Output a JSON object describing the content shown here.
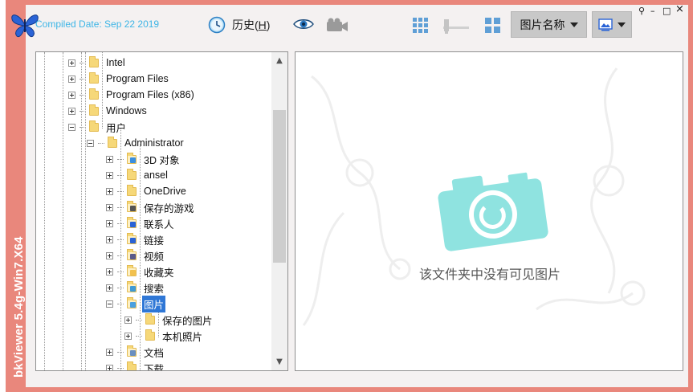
{
  "app": {
    "vertical_title": "bkViewer 5.4g-Win7.X64",
    "compiled_date": "Compiled Date: Sep 22 2019"
  },
  "toolbar": {
    "history_label": "历史",
    "history_hotkey": "H",
    "sort_label": "图片名称",
    "icons": [
      "history-clock-icon",
      "eye-icon",
      "camera-icon",
      "grid-large-icon",
      "slider-icon",
      "grid-small-icon",
      "image-view-icon"
    ]
  },
  "window_controls": {
    "pin": "⚲",
    "minimize": "–",
    "maximize": "□",
    "close": "×"
  },
  "tree": {
    "nodes": [
      {
        "label": "Intel",
        "level": 2,
        "expander": "plus",
        "icon": "folder-icon"
      },
      {
        "label": "Program Files",
        "level": 2,
        "expander": "plus",
        "icon": "folder-icon"
      },
      {
        "label": "Program Files (x86)",
        "level": 2,
        "expander": "plus",
        "icon": "folder-icon"
      },
      {
        "label": "Windows",
        "level": 2,
        "expander": "plus",
        "icon": "folder-icon"
      },
      {
        "label": "用户",
        "level": 2,
        "expander": "minus",
        "icon": "folder-icon"
      },
      {
        "label": "Administrator",
        "level": 3,
        "expander": "minus",
        "icon": "folder-icon"
      },
      {
        "label": "3D 对象",
        "level": 4,
        "expander": "plus",
        "icon": "3d-objects-icon"
      },
      {
        "label": "ansel",
        "level": 4,
        "expander": "plus",
        "icon": "folder-icon"
      },
      {
        "label": "OneDrive",
        "level": 4,
        "expander": "plus",
        "icon": "folder-icon"
      },
      {
        "label": "保存的游戏",
        "level": 4,
        "expander": "plus",
        "icon": "saved-games-icon"
      },
      {
        "label": "联系人",
        "level": 4,
        "expander": "plus",
        "icon": "contacts-icon"
      },
      {
        "label": "链接",
        "level": 4,
        "expander": "plus",
        "icon": "links-icon"
      },
      {
        "label": "视频",
        "level": 4,
        "expander": "plus",
        "icon": "videos-icon"
      },
      {
        "label": "收藏夹",
        "level": 4,
        "expander": "plus",
        "icon": "favorites-icon"
      },
      {
        "label": "搜索",
        "level": 4,
        "expander": "plus",
        "icon": "search-icon"
      },
      {
        "label": "图片",
        "level": 4,
        "expander": "minus",
        "icon": "pictures-icon",
        "selected": true
      },
      {
        "label": "保存的图片",
        "level": 5,
        "expander": "plus",
        "icon": "folder-icon"
      },
      {
        "label": "本机照片",
        "level": 5,
        "expander": "plus",
        "icon": "folder-icon"
      },
      {
        "label": "文档",
        "level": 4,
        "expander": "plus",
        "icon": "documents-icon"
      },
      {
        "label": "下载",
        "level": 4,
        "expander": "plus",
        "icon": "folder-icon"
      }
    ]
  },
  "preview": {
    "empty_message": "该文件夹中没有可见图片"
  },
  "colors": {
    "frame": "#e9877c",
    "accent_text": "#3db5e6",
    "selection": "#2f77d6",
    "camera": "#8fe3e0"
  }
}
